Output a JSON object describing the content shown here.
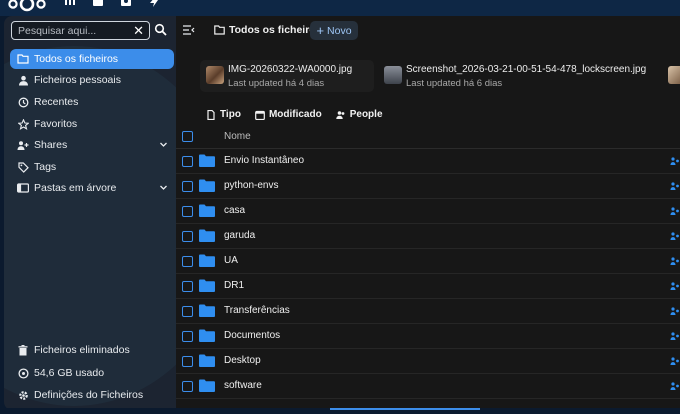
{
  "colors": {
    "accent": "#3c8dea",
    "folder": "#2f8ef0",
    "sidebar_bg": "#1c2431",
    "main_bg": "#171717"
  },
  "header": {
    "logo_icon": "nextcloud-logo-icon",
    "apps": [
      "dashboard-icon",
      "files-icon",
      "photos-icon",
      "activity-icon"
    ]
  },
  "sidebar": {
    "search": {
      "placeholder": "Pesquisar aqui..."
    },
    "items": [
      {
        "label": "Todos os ficheiros",
        "icon": "folder-icon",
        "active": true
      },
      {
        "label": "Ficheiros pessoais",
        "icon": "user-icon"
      },
      {
        "label": "Recentes",
        "icon": "history-icon"
      },
      {
        "label": "Favoritos",
        "icon": "star-icon"
      },
      {
        "label": "Shares",
        "icon": "share-icon",
        "expandable": true
      },
      {
        "label": "Tags",
        "icon": "tag-icon"
      },
      {
        "label": "Pastas em árvore",
        "icon": "folder-tree-icon",
        "expandable": true
      }
    ],
    "bottom": [
      {
        "label": "Ficheiros eliminados",
        "icon": "trash-icon"
      },
      {
        "label": "54,6 GB usado",
        "icon": "quota-icon"
      },
      {
        "label": "Definições do Ficheiros",
        "icon": "settings-icon"
      }
    ]
  },
  "main": {
    "breadcrumb": "Todos os ficheiros",
    "new_label": "Novo",
    "recent": [
      {
        "name": "IMG-20260322-WA0000.jpg",
        "meta": "Last updated há 4 dias"
      },
      {
        "name": "Screenshot_2026-03-21-00-51-54-478_lockscreen.jpg",
        "meta": "Last updated há 6 dias"
      }
    ],
    "filters": [
      "Tipo",
      "Modificado",
      "People"
    ],
    "column_name": "Nome",
    "files": [
      "Envio Instantâneo",
      "python-envs",
      "casa",
      "garuda",
      "UA",
      "DR1",
      "Transferências",
      "Documentos",
      "Desktop",
      "software"
    ]
  }
}
